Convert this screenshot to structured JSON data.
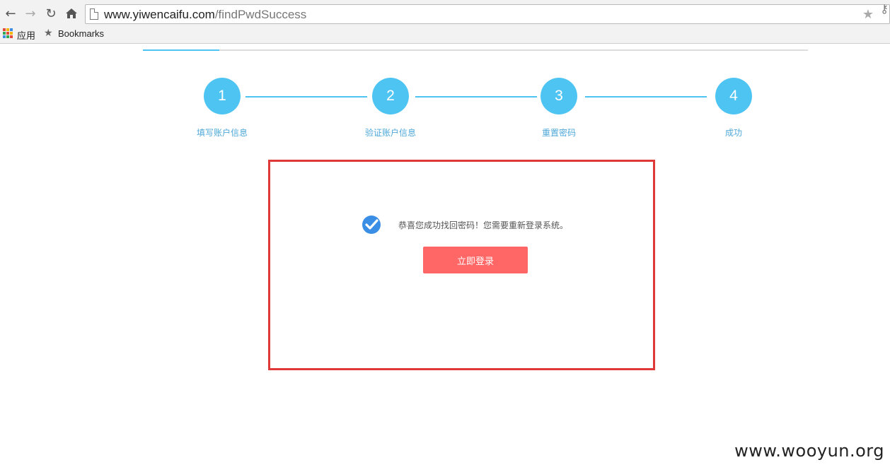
{
  "browser": {
    "url_host": "www.yiwencaifu.com",
    "url_path": "/findPwdSuccess",
    "bookmarks_bar": {
      "apps_label": "应用",
      "bookmarks_label": "Bookmarks"
    },
    "icons": [
      "back-icon",
      "forward-icon",
      "reload-icon",
      "home-icon",
      "page-icon",
      "star-icon",
      "key-icon",
      "apps-icon"
    ]
  },
  "steps": [
    {
      "number": "1",
      "label": "填写账户信息"
    },
    {
      "number": "2",
      "label": "验证账户信息"
    },
    {
      "number": "3",
      "label": "重置密码"
    },
    {
      "number": "4",
      "label": "成功"
    }
  ],
  "success": {
    "message": "恭喜您成功找回密码！您需要重新登录系统。",
    "button_label": "立即登录"
  },
  "colors": {
    "accent": "#4ec4f3",
    "step_label": "#4ea8d8",
    "button": "#ff6666",
    "highlight_border": "#e0393a",
    "check": "#3a8ee6"
  },
  "watermark": "www.wooyun.org"
}
